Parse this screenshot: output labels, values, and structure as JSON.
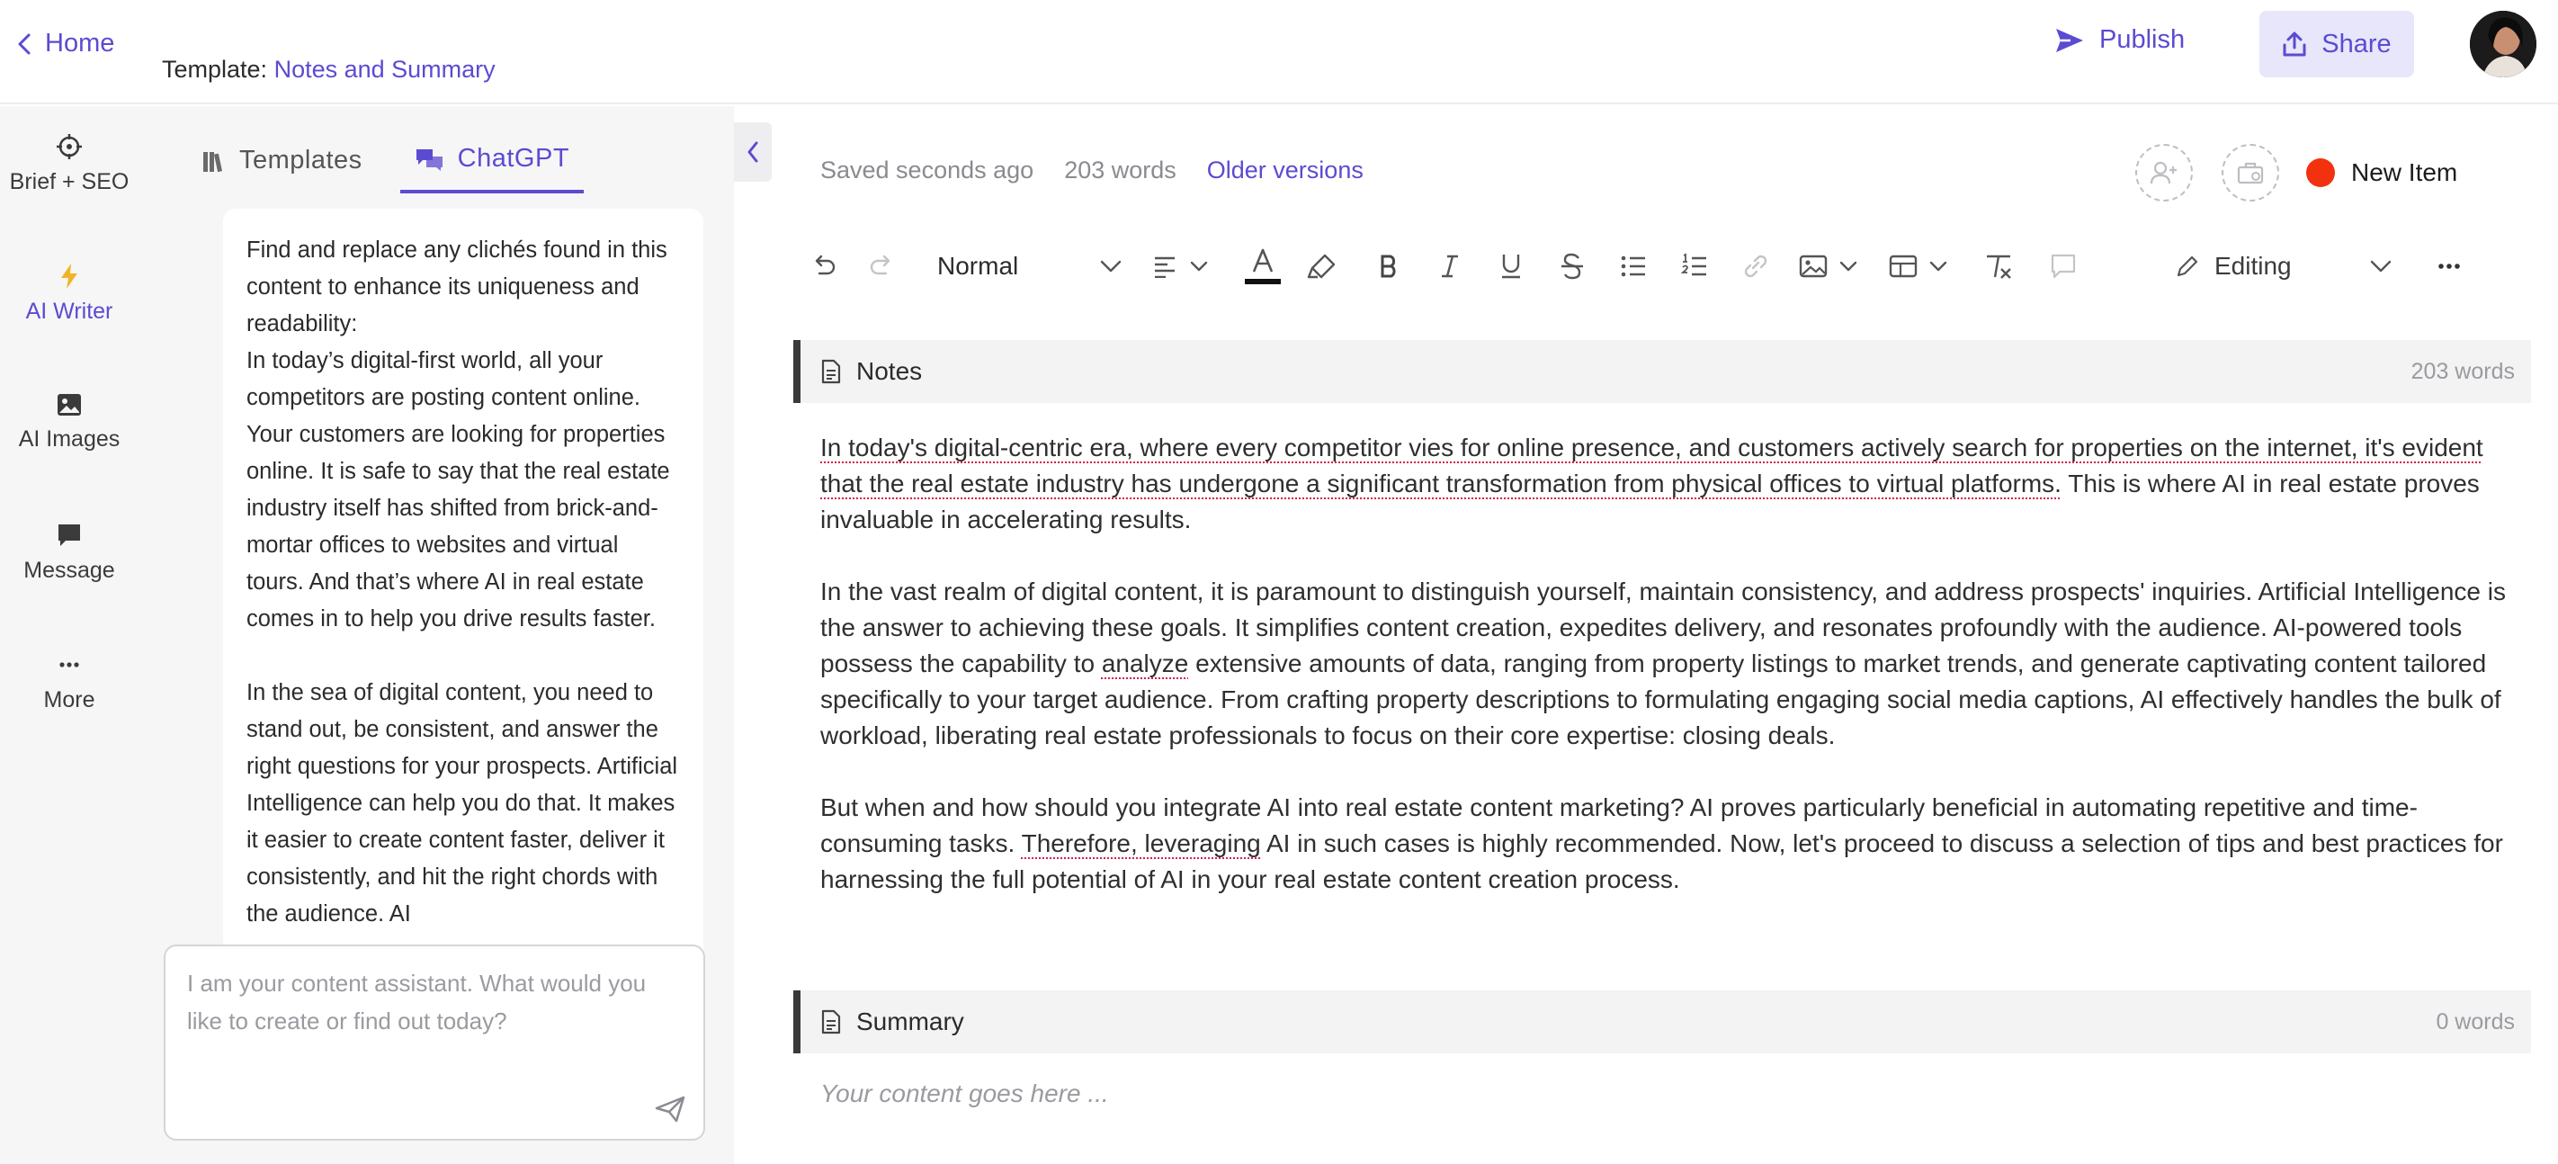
{
  "header": {
    "home_label": "Home",
    "template_prefix": "Template:",
    "template_name": "Notes and Summary",
    "publish_label": "Publish",
    "share_label": "Share"
  },
  "rail": {
    "items": [
      {
        "label": "Brief + SEO",
        "icon": "crosshair-icon"
      },
      {
        "label": "AI Writer",
        "icon": "lightning-icon",
        "active": true
      },
      {
        "label": "AI Images",
        "icon": "image-icon"
      },
      {
        "label": "Message",
        "icon": "chat-bubble-icon"
      },
      {
        "label": "More",
        "icon": "ellipsis-icon"
      }
    ]
  },
  "chat": {
    "tabs": [
      {
        "label": "Templates",
        "icon": "library-icon"
      },
      {
        "label": "ChatGPT",
        "icon": "chat-icon",
        "active": true
      }
    ],
    "message_paragraphs": [
      "Find and replace any clichés found in this content to enhance its uniqueness and readability:\nIn today’s digital-first world, all your competitors are posting content online. Your customers are looking for properties online. It is safe to say that the real estate industry itself has shifted from brick-and-mortar offices to websites and virtual tours. And that’s where AI in real estate comes in to help you drive results faster.",
      "In the sea of digital content, you need to stand out, be consistent, and answer the right questions for your prospects. Artificial Intelligence can help you do that. It makes it easier to create content faster, deliver it consistently, and hit the right chords with the audience. AI"
    ],
    "input_placeholder": "I am your content assistant. What would you like to create or find out today?"
  },
  "editor": {
    "saved_status": "Saved seconds ago",
    "word_count": "203 words",
    "older_versions": "Older versions",
    "new_item_label": "New Item",
    "new_item_color": "#f2320f",
    "toolbar": {
      "style_value": "Normal",
      "editing_label": "Editing"
    },
    "notes": {
      "title": "Notes",
      "count": "203 words",
      "paragraphs": [
        [
          "",
          "In today's digital-centric era, where every competitor vies for online presence, and customers actively search for properties on the internet, it's evident that the real estate industry has undergone a significant transformation from physical offices to virtual platforms.",
          " This is where AI in real estate proves invaluable in accelerating results."
        ],
        [
          "In the vast realm of digital content, it is paramount to distinguish yourself, maintain consistency, and address prospects' inquiries. Artificial Intelligence is the answer to achieving these goals. It simplifies content creation, expedites delivery, and resonates profoundly with the audience. AI-powered tools possess the capability to ",
          "analyze",
          " extensive amounts of data, ranging from property listings to market trends, and generate captivating content tailored specifically to your target audience. From crafting property descriptions to formulating engaging social media captions, AI effectively handles the bulk of workload, liberating real estate professionals to focus on their core expertise: closing deals."
        ],
        [
          "But when and how should you integrate AI into real estate content marketing? AI proves particularly beneficial in automating repetitive and time-consuming tasks. ",
          "Therefore, leveraging",
          " AI in such cases is highly recommended. Now, let's proceed to discuss a selection of tips and best practices for harnessing the full potential of AI in your real estate content creation process."
        ]
      ]
    },
    "summary": {
      "title": "Summary",
      "count": "0 words",
      "placeholder": "Your content goes here ..."
    }
  },
  "colors": {
    "accent": "#5b4bd1",
    "share_bg": "#e7e6fa",
    "panel_bg": "#f6f6f7"
  }
}
